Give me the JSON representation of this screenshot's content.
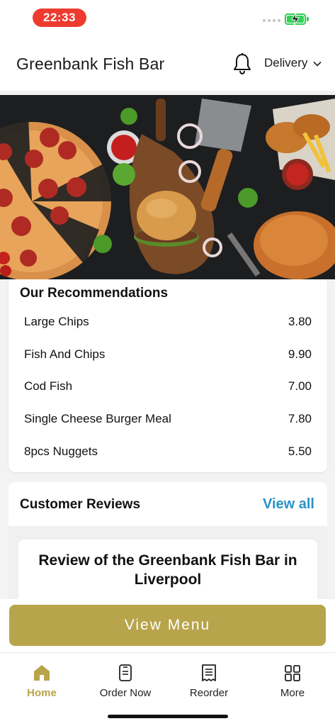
{
  "status_bar": {
    "time": "22:33"
  },
  "header": {
    "title": "Greenbank Fish Bar",
    "icon": "bell-icon",
    "mode_label": "Delivery"
  },
  "recommendations": {
    "title": "Our Recommendations",
    "items": [
      {
        "name": "Large Chips",
        "price": "3.80"
      },
      {
        "name": "Fish And Chips",
        "price": "9.90"
      },
      {
        "name": "Cod Fish",
        "price": "7.00"
      },
      {
        "name": "Single Cheese Burger Meal",
        "price": "7.80"
      },
      {
        "name": "8pcs Nuggets",
        "price": "5.50"
      }
    ]
  },
  "reviews": {
    "title": "Customer Reviews",
    "view_all": "View all",
    "items": [
      {
        "title": "Review of the Greenbank Fish Bar in Liverpool"
      }
    ]
  },
  "view_menu_label": "View Menu",
  "tabs": [
    {
      "label": "Home",
      "icon": "home-icon",
      "active": true
    },
    {
      "label": "Order Now",
      "icon": "order-icon",
      "active": false
    },
    {
      "label": "Reorder",
      "icon": "receipt-icon",
      "active": false
    },
    {
      "label": "More",
      "icon": "grid-icon",
      "active": false
    }
  ],
  "colors": {
    "accent": "#b8a44a",
    "link": "#2a93c4",
    "time_pill": "#ee3b2f",
    "battery": "#34d058"
  }
}
